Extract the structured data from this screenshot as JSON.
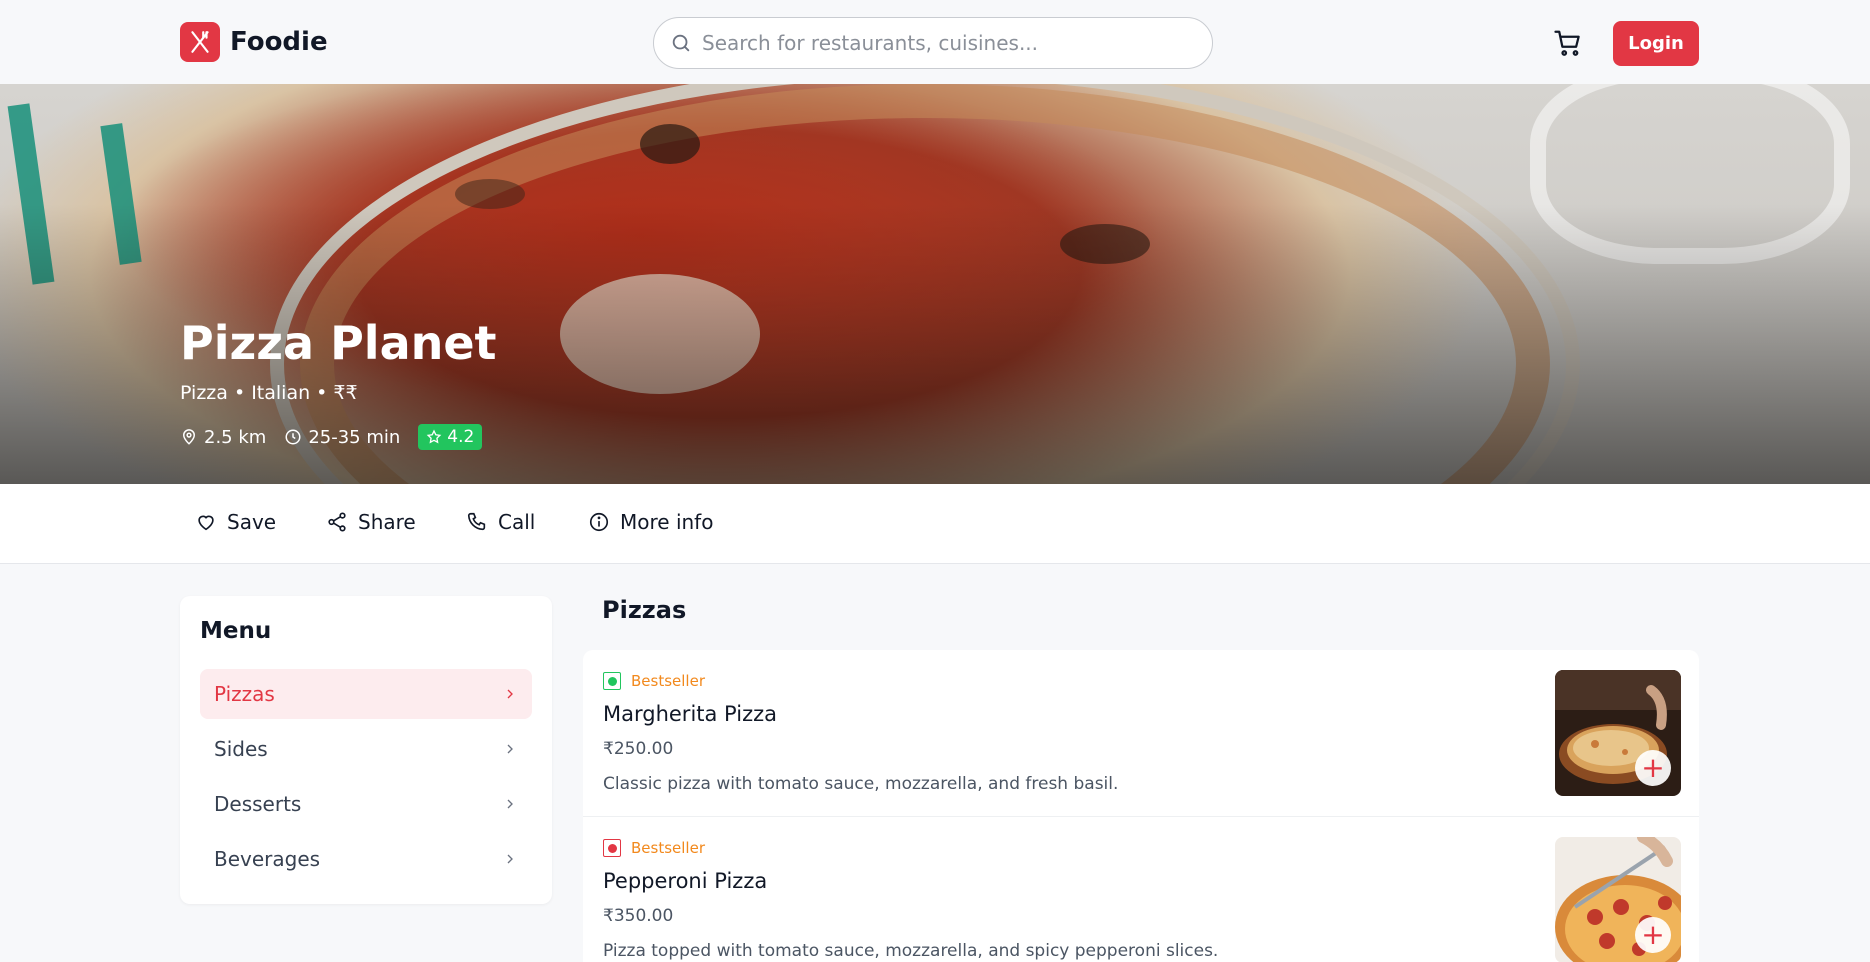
{
  "brand": {
    "name": "Foodie",
    "accent": "#e23744"
  },
  "search": {
    "placeholder": "Search for restaurants, cuisines..."
  },
  "header": {
    "login_label": "Login",
    "cart_icon": "cart-icon"
  },
  "restaurant": {
    "name": "Pizza Planet",
    "tags": "Pizza • Italian • ₹₹",
    "distance": "2.5 km",
    "delivery_time": "25-35 min",
    "rating": "4.2"
  },
  "actions": [
    {
      "label": "Save",
      "icon": "heart-icon"
    },
    {
      "label": "Share",
      "icon": "share-icon"
    },
    {
      "label": "Call",
      "icon": "phone-icon"
    },
    {
      "label": "More info",
      "icon": "info-icon"
    }
  ],
  "sidebar": {
    "title": "Menu",
    "items": [
      {
        "label": "Pizzas",
        "active": true
      },
      {
        "label": "Sides",
        "active": false
      },
      {
        "label": "Desserts",
        "active": false
      },
      {
        "label": "Beverages",
        "active": false
      }
    ]
  },
  "main": {
    "section_title": "Pizzas",
    "items": [
      {
        "badge": "Bestseller",
        "diet": "veg",
        "name": "Margherita Pizza",
        "price": "₹250.00",
        "description": "Classic pizza with tomato sauce, mozzarella, and fresh basil."
      },
      {
        "badge": "Bestseller",
        "diet": "non-veg",
        "name": "Pepperoni Pizza",
        "price": "₹350.00",
        "description": "Pizza topped with tomato sauce, mozzarella, and spicy pepperoni slices."
      }
    ]
  },
  "colors": {
    "veg": "#22c55e",
    "non_veg": "#e23744",
    "bestseller": "#f2891d",
    "rating_bg": "#22c55e"
  }
}
